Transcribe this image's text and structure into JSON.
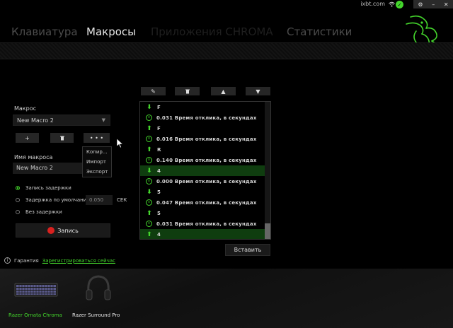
{
  "topbar": {
    "user": "ixbt.com",
    "status_icon": "✓",
    "window_buttons": [
      "⚙",
      "–",
      "✕"
    ]
  },
  "nav": {
    "tabs": [
      "Клавиатура",
      "Макросы",
      "Приложения CHROMA",
      "Статистики"
    ],
    "active": "Макросы"
  },
  "macro_panel": {
    "macro_label": "Макрос",
    "macro_selected": "New Macro 2",
    "add_label": "+",
    "delete_label": "🗑",
    "more_label": "• • •",
    "menu_items": [
      "Копир...",
      "Импорт",
      "Экспорт"
    ],
    "name_label": "Имя макроса",
    "name_value": "New Macro 2",
    "delay_options": [
      "Запись задержки",
      "Задержка по умолчанию",
      "Без задержки"
    ],
    "selected_delay": "Запись задержки",
    "default_delay_value": "0.050",
    "delay_unit": "СЕК",
    "record_label": "Запись"
  },
  "editor": {
    "toolbar": [
      "✎",
      "🗑",
      "▲",
      "▼"
    ],
    "rows": [
      {
        "kind": "down",
        "text": "F"
      },
      {
        "kind": "delay",
        "text": "0.031 Время отклика, в секундах"
      },
      {
        "kind": "up",
        "text": "F"
      },
      {
        "kind": "delay",
        "text": "0.016 Время отклика, в секундах"
      },
      {
        "kind": "up",
        "text": "R"
      },
      {
        "kind": "delay",
        "text": "0.140 Время отклика, в секундах"
      },
      {
        "kind": "down",
        "text": "4",
        "selected": true
      },
      {
        "kind": "delay",
        "text": "0.000 Время отклика, в секундах"
      },
      {
        "kind": "down",
        "text": "5"
      },
      {
        "kind": "delay",
        "text": "0.047 Время отклика, в секундах"
      },
      {
        "kind": "up",
        "text": "5"
      },
      {
        "kind": "delay",
        "text": "0.031 Время отклика, в секундах"
      },
      {
        "kind": "up",
        "text": "4",
        "selected": true
      }
    ],
    "insert_label": "Вставить"
  },
  "footer": {
    "warranty_label": "Гарантия",
    "register_link": "Зарегистрироваться сейчас",
    "devices": [
      {
        "name": "Razer Ornata Chroma",
        "color": "#44d62c"
      },
      {
        "name": "Razer Surround Pro",
        "color": "#e6e6e6"
      }
    ]
  },
  "colors": {
    "accent": "#44d62c",
    "record": "#d9211f"
  }
}
